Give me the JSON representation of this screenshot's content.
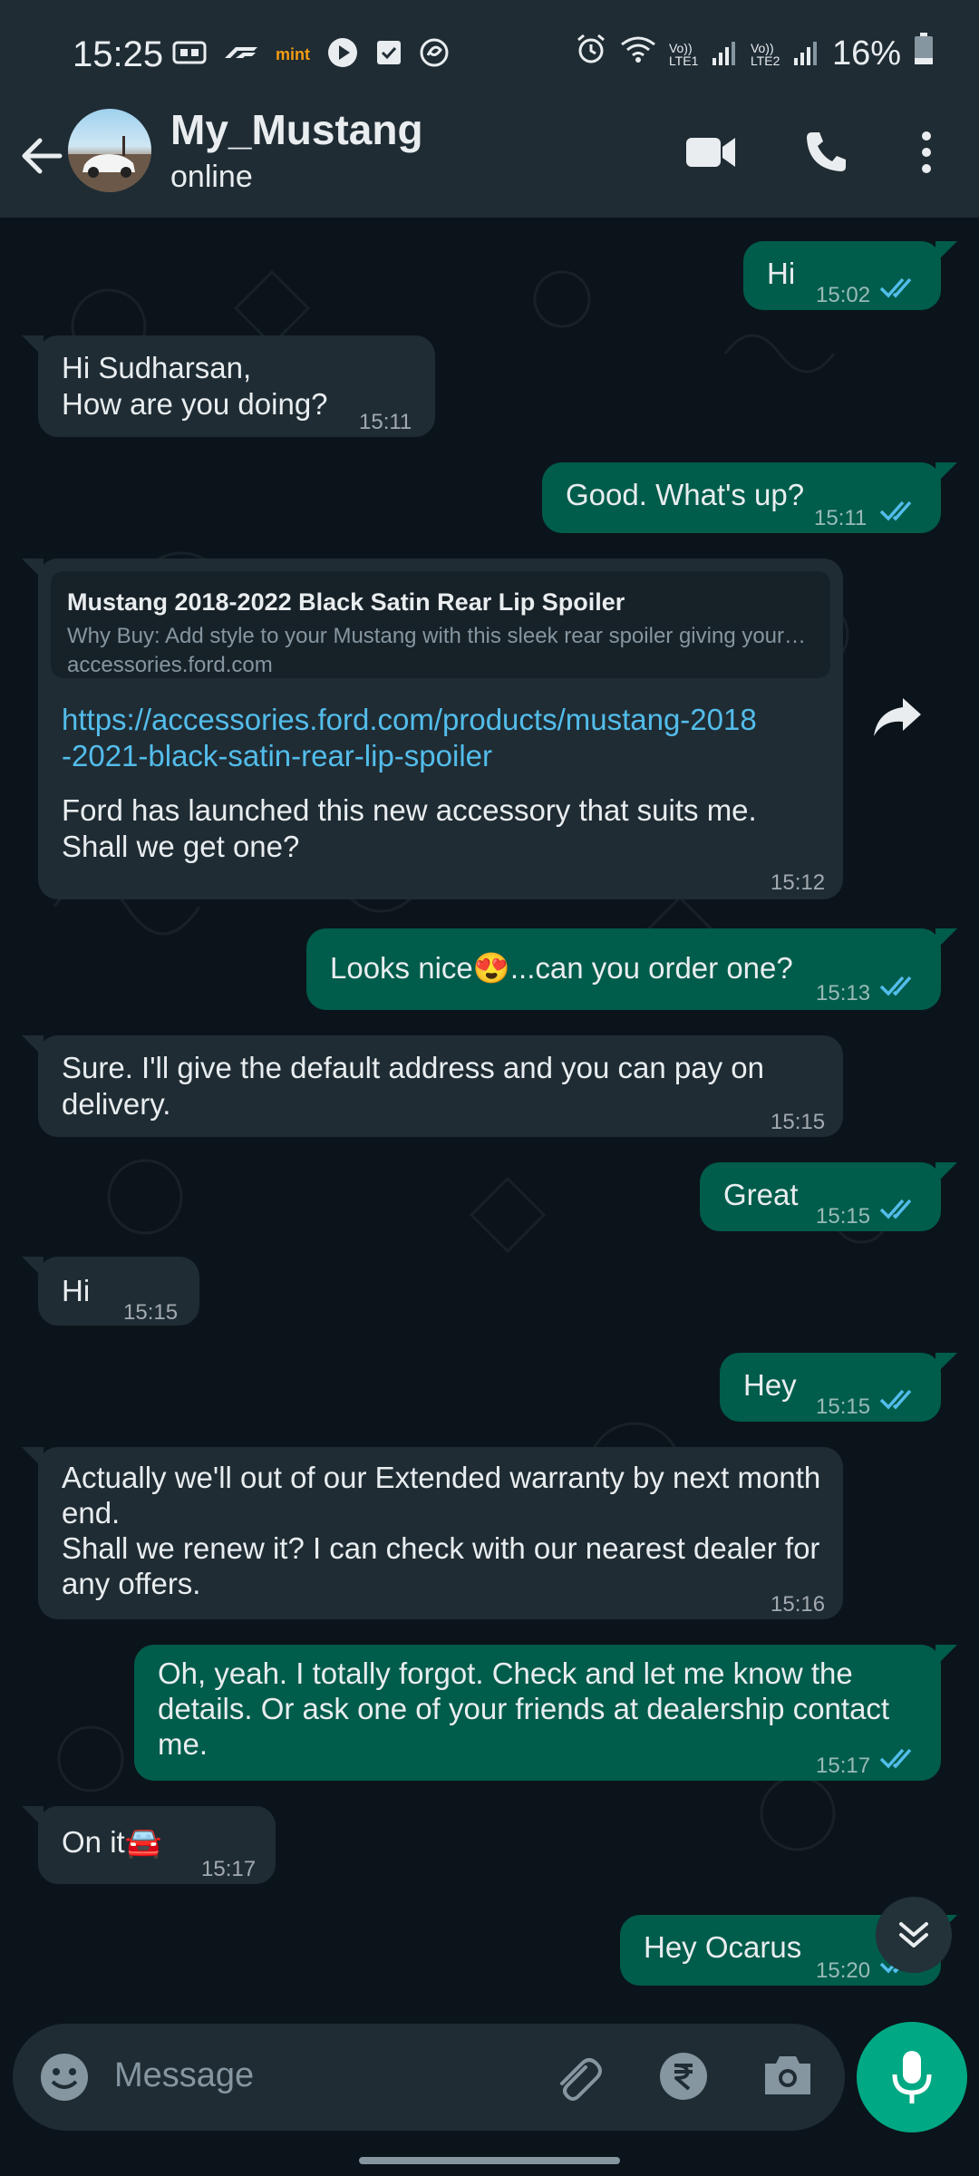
{
  "status_bar": {
    "time": "15:25",
    "left_icons": [
      "youtube-tv-icon",
      "f1-icon",
      "mint-icon",
      "play-icon",
      "checkbox-icon",
      "swirl-icon"
    ],
    "mint_text": "mint",
    "sim1_label": "Vo)) LTE1",
    "sim2_label": "Vo)) LTE2",
    "battery": "16%"
  },
  "header": {
    "contact_name": "My_Mustang",
    "status": "online"
  },
  "messages": [
    {
      "dir": "out",
      "text": "Hi",
      "time": "15:02"
    },
    {
      "dir": "in",
      "text_lines": [
        "Hi Sudharsan,",
        "How are you doing?"
      ],
      "time": "15:11"
    },
    {
      "dir": "out",
      "text": "Good. What's up?",
      "time": "15:11"
    },
    {
      "dir": "in",
      "preview": {
        "title": "Mustang 2018-2022 Black Satin Rear Lip Spoiler",
        "description": "Why Buy: Add style to your Mustang with this sleek rear spoiler giving your…",
        "domain": "accessories.ford.com"
      },
      "link_lines": [
        "https://accessories.ford.com/products/mustang-2018",
        "-2021-black-satin-rear-lip-spoiler"
      ],
      "text_lines": [
        "Ford has launched this new accessory that suits me.",
        "Shall we get one?"
      ],
      "time": "15:12"
    },
    {
      "dir": "out",
      "text_before": "Looks nice",
      "emoji": "😍",
      "text_after": "...can you order one?",
      "time": "15:13"
    },
    {
      "dir": "in",
      "text_lines": [
        "Sure. I'll give the default address and you can pay on",
        "delivery."
      ],
      "time": "15:15"
    },
    {
      "dir": "out",
      "text": "Great",
      "time": "15:15"
    },
    {
      "dir": "in",
      "text": "Hi",
      "time": "15:15"
    },
    {
      "dir": "out",
      "text": "Hey",
      "time": "15:15"
    },
    {
      "dir": "in",
      "text_lines": [
        "Actually we'll out of our Extended warranty by next month",
        "end.",
        "Shall we renew it? I can check with our nearest dealer for",
        "any offers."
      ],
      "time": "15:16"
    },
    {
      "dir": "out",
      "text_lines": [
        "Oh, yeah. I totally forgot. Check and let me know the",
        "details. Or ask one of your friends at dealership contact",
        "me."
      ],
      "time": "15:17"
    },
    {
      "dir": "in",
      "text": "On it",
      "emoji": "🚘",
      "time": "15:17"
    },
    {
      "dir": "out",
      "text": "Hey Ocarus",
      "time": "15:20"
    }
  ],
  "input": {
    "placeholder": "Message"
  },
  "colors": {
    "background": "#0b141a",
    "bar": "#1f2c34",
    "outgoing": "#005c4b",
    "incoming": "#1f2c34",
    "accent": "#00a884",
    "tick": "#53bdeb",
    "link": "#53bdeb"
  }
}
